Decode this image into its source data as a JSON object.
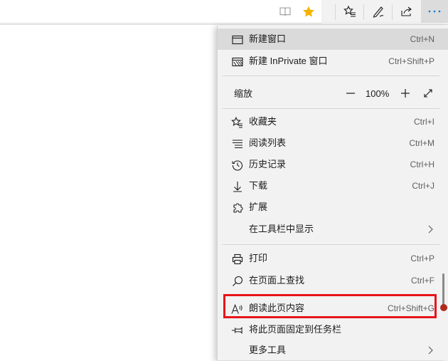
{
  "toolbar": {
    "icons": [
      "reading-view-icon",
      "favorite-star-icon",
      "favorites-list-icon",
      "notes-icon",
      "share-icon",
      "more-icon"
    ],
    "star_color": "#f5b400",
    "more_color": "#0078d7"
  },
  "menu": {
    "new_window": {
      "label": "新建窗口",
      "shortcut": "Ctrl+N"
    },
    "new_inprivate": {
      "label": "新建 InPrivate 窗口",
      "shortcut": "Ctrl+Shift+P"
    },
    "zoom": {
      "label": "缩放",
      "value": "100%"
    },
    "favorites": {
      "label": "收藏夹",
      "shortcut": "Ctrl+I"
    },
    "reading_list": {
      "label": "阅读列表",
      "shortcut": "Ctrl+M"
    },
    "history": {
      "label": "历史记录",
      "shortcut": "Ctrl+H"
    },
    "downloads": {
      "label": "下载",
      "shortcut": "Ctrl+J"
    },
    "extensions": {
      "label": "扩展"
    },
    "show_in_toolbar": {
      "label": "在工具栏中显示"
    },
    "print": {
      "label": "打印",
      "shortcut": "Ctrl+P"
    },
    "find": {
      "label": "在页面上查找",
      "shortcut": "Ctrl+F"
    },
    "read_aloud": {
      "label": "朗读此页内容",
      "shortcut": "Ctrl+Shift+G"
    },
    "pin_taskbar": {
      "label": "将此页面固定到任务栏"
    },
    "more_tools": {
      "label": "更多工具"
    }
  },
  "annotation": {
    "box_color": "#e8141a"
  }
}
